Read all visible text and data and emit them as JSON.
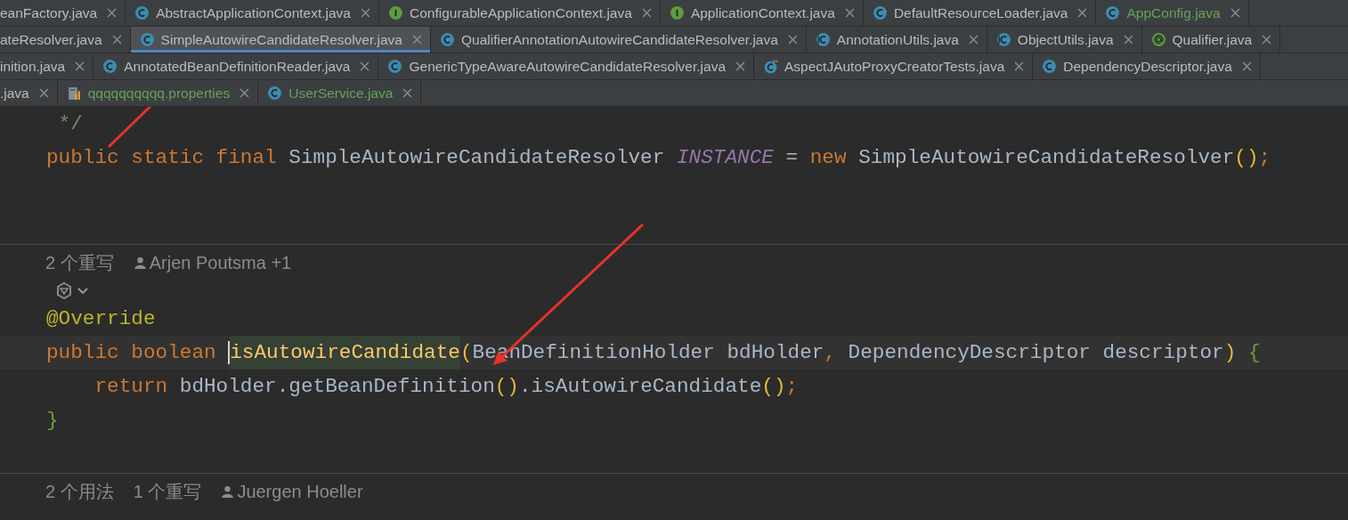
{
  "tab_rows": [
    [
      {
        "label": "eanFactory.java",
        "kind": "none",
        "color": "#bbbbbb",
        "selected": false
      },
      {
        "label": "AbstractApplicationContext.java",
        "kind": "class",
        "color": "#bbbbbb",
        "selected": false
      },
      {
        "label": "ConfigurableApplicationContext.java",
        "kind": "interface",
        "color": "#bbbbbb",
        "selected": false
      },
      {
        "label": "ApplicationContext.java",
        "kind": "interface",
        "color": "#bbbbbb",
        "selected": false
      },
      {
        "label": "DefaultResourceLoader.java",
        "kind": "class",
        "color": "#bbbbbb",
        "selected": false
      },
      {
        "label": "AppConfig.java",
        "kind": "class",
        "color": "#62a35c",
        "selected": false
      }
    ],
    [
      {
        "label": "ateResolver.java",
        "kind": "none",
        "color": "#bbbbbb",
        "selected": false
      },
      {
        "label": "SimpleAutowireCandidateResolver.java",
        "kind": "class",
        "color": "#bbbbbb",
        "selected": true
      },
      {
        "label": "QualifierAnnotationAutowireCandidateResolver.java",
        "kind": "class",
        "color": "#bbbbbb",
        "selected": false
      },
      {
        "label": "AnnotationUtils.java",
        "kind": "abstract",
        "color": "#bbbbbb",
        "selected": false
      },
      {
        "label": "ObjectUtils.java",
        "kind": "abstract",
        "color": "#bbbbbb",
        "selected": false
      },
      {
        "label": "Qualifier.java",
        "kind": "annotation",
        "color": "#bbbbbb",
        "selected": false
      }
    ],
    [
      {
        "label": "inition.java",
        "kind": "none",
        "color": "#bbbbbb",
        "selected": false
      },
      {
        "label": "AnnotatedBeanDefinitionReader.java",
        "kind": "class",
        "color": "#bbbbbb",
        "selected": false
      },
      {
        "label": "GenericTypeAwareAutowireCandidateResolver.java",
        "kind": "class",
        "color": "#bbbbbb",
        "selected": false
      },
      {
        "label": "AspectJAutoProxyCreatorTests.java",
        "kind": "test",
        "color": "#bbbbbb",
        "selected": false
      },
      {
        "label": "DependencyDescriptor.java",
        "kind": "class",
        "color": "#bbbbbb",
        "selected": false
      }
    ],
    [
      {
        "label": ".java",
        "kind": "none",
        "color": "#bbbbbb",
        "selected": false
      },
      {
        "label": "qqqqqqqqqq.properties",
        "kind": "properties",
        "color": "#62a35c",
        "selected": false
      },
      {
        "label": "UserService.java",
        "kind": "class",
        "color": "#62a35c",
        "selected": false
      }
    ]
  ],
  "editor": [
    {
      "kind": "code",
      "tokens": [
        {
          "t": " */",
          "kind": "comment"
        }
      ]
    },
    {
      "kind": "code",
      "tokens": [
        {
          "t": "public static final ",
          "kind": "keyword"
        },
        {
          "t": "SimpleAutowireCandidateResolver ",
          "kind": "text"
        },
        {
          "t": "INSTANCE",
          "kind": "constant"
        },
        {
          "t": " = ",
          "kind": "text"
        },
        {
          "t": "new ",
          "kind": "keyword"
        },
        {
          "t": "SimpleAutowireCandidateResolver",
          "kind": "text"
        },
        {
          "t": "()",
          "kind": "paren"
        },
        {
          "t": ";",
          "kind": "keyword"
        }
      ]
    },
    {
      "kind": "blank"
    },
    {
      "kind": "blank"
    },
    {
      "kind": "separator"
    },
    {
      "kind": "inlay",
      "parts": [
        {
          "t": "2 个重写",
          "kind": "count"
        },
        {
          "t": "Arjen Poutsma +1",
          "kind": "author"
        }
      ]
    },
    {
      "kind": "gutter-icon"
    },
    {
      "kind": "code",
      "tokens": [
        {
          "t": "@Override",
          "kind": "annotation"
        }
      ]
    },
    {
      "kind": "code",
      "current": true,
      "tokens": [
        {
          "t": "public boolean ",
          "kind": "keyword"
        },
        {
          "t": "isAutowireCandidate",
          "kind": "method"
        },
        {
          "t": "(",
          "kind": "paren"
        },
        {
          "t": "BeanDefinitionHolder bdHolder",
          "kind": "text"
        },
        {
          "t": ", ",
          "kind": "keyword"
        },
        {
          "t": "DependencyDescriptor descriptor",
          "kind": "text"
        },
        {
          "t": ") ",
          "kind": "paren"
        },
        {
          "t": "{",
          "kind": "brace"
        }
      ]
    },
    {
      "kind": "code",
      "tokens": [
        {
          "t": "    return ",
          "kind": "keyword"
        },
        {
          "t": "bdHolder.getBeanDefinition",
          "kind": "text"
        },
        {
          "t": "()",
          "kind": "paren"
        },
        {
          "t": ".isAutowireCandidate",
          "kind": "text"
        },
        {
          "t": "()",
          "kind": "paren"
        },
        {
          "t": ";",
          "kind": "keyword"
        }
      ]
    },
    {
      "kind": "code",
      "tokens": [
        {
          "t": "}",
          "kind": "brace"
        }
      ]
    },
    {
      "kind": "blank"
    },
    {
      "kind": "separator"
    },
    {
      "kind": "inlay",
      "parts": [
        {
          "t": "2 个用法",
          "kind": "count"
        },
        {
          "t": "1 个重写",
          "kind": "count"
        },
        {
          "t": "Juergen Hoeller",
          "kind": "author"
        }
      ]
    }
  ]
}
